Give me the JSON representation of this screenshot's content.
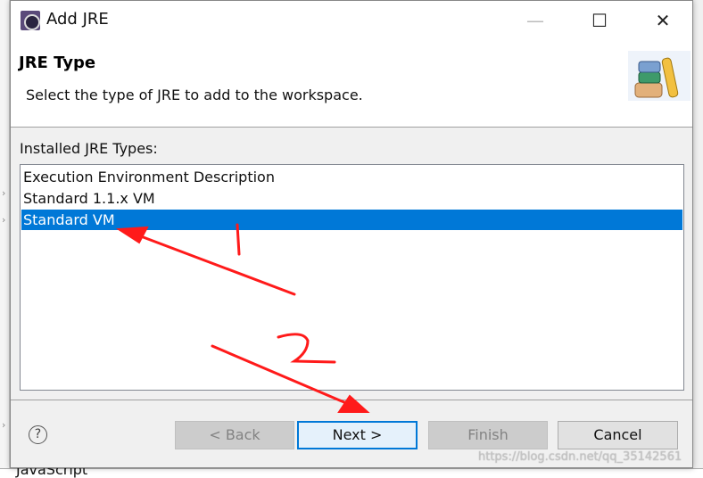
{
  "background": {
    "partial_label": "JavaScript"
  },
  "dialog": {
    "title": "Add JRE",
    "window_controls": {
      "minimize": "—",
      "maximize": "☐",
      "close": "✕"
    },
    "header": {
      "title": "JRE Type",
      "description": "Select the type of JRE to add to the workspace."
    },
    "list_label": "Installed JRE Types:",
    "list_items": [
      {
        "label": "Execution Environment Description",
        "selected": false
      },
      {
        "label": "Standard 1.1.x VM",
        "selected": false
      },
      {
        "label": "Standard VM",
        "selected": true
      }
    ],
    "buttons": {
      "help": "?",
      "back": "< Back",
      "next": "Next >",
      "finish": "Finish",
      "cancel": "Cancel"
    },
    "selection_color": "#0078d7"
  },
  "annotations": {
    "color": "#ff1a1a",
    "step1": "1",
    "step2": "2"
  },
  "watermark": "https://blog.csdn.net/qq_35142561"
}
